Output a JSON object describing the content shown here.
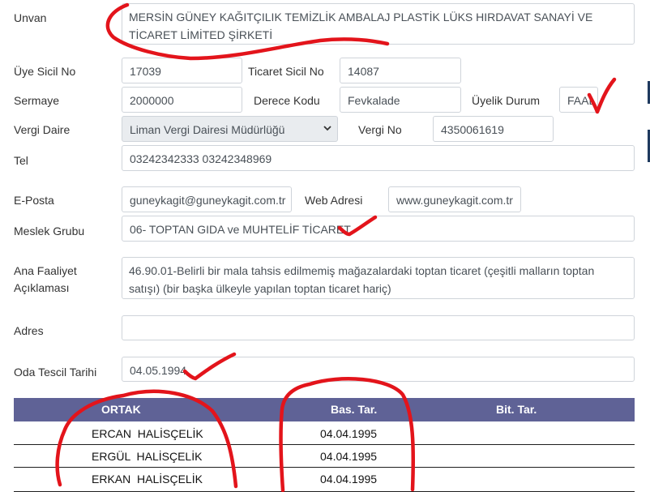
{
  "form": {
    "unvan": {
      "label": "Unvan",
      "value": "MERSİN GÜNEY KAĞITÇILIK TEMİZLİK AMBALAJ PLASTİK LÜKS HIRDAVAT SANAYİ VE TİCARET LİMİTED ŞİRKETİ"
    },
    "uye_sicil_no": {
      "label": "Üye Sicil No",
      "value": "17039"
    },
    "ticaret_sicil_no": {
      "label": "Ticaret Sicil No",
      "value": "14087"
    },
    "sermaye": {
      "label": "Sermaye",
      "value": "2000000"
    },
    "derece_kodu": {
      "label": "Derece Kodu",
      "value": "Fevkalade"
    },
    "uyelik_durum": {
      "label": "Üyelik Durum",
      "value": "FAAL"
    },
    "vergi_daire": {
      "label": "Vergi Daire",
      "value": "Liman Vergi Dairesi Müdürlüğü"
    },
    "vergi_no": {
      "label": "Vergi No",
      "value": "4350061619"
    },
    "tel": {
      "label": "Tel",
      "value": "03242342333 03242348969"
    },
    "e_posta": {
      "label": "E-Posta",
      "value": "guneykagit@guneykagit.com.tr"
    },
    "web_adresi": {
      "label": "Web Adresi",
      "value": "www.guneykagit.com.tr"
    },
    "meslek_grubu": {
      "label": "Meslek Grubu",
      "value": "06- TOPTAN GIDA ve MUHTELİF TİCARET"
    },
    "ana_faaliyet": {
      "label": "Ana Faaliyet Açıklaması",
      "value": "46.90.01-Belirli bir mala tahsis edilmemiş mağazalardaki toptan ticaret (çeşitli malların toptan satışı) (bir başka ülkeyle yapılan toptan ticaret hariç)"
    },
    "adres": {
      "label": "Adres",
      "value": ""
    },
    "oda_tescil_tarihi": {
      "label": "Oda Tescil Tarihi",
      "value": "04.05.1994"
    }
  },
  "partners_table": {
    "headers": [
      "ORTAK",
      "Bas. Tar.",
      "Bit. Tar."
    ],
    "rows": [
      {
        "ortak": "ERCAN  HALİSÇELİK",
        "bas_tar": "04.04.1995",
        "bit_tar": ""
      },
      {
        "ortak": "ERGÜL  HALİSÇELİK",
        "bas_tar": "04.04.1995",
        "bit_tar": ""
      },
      {
        "ortak": "ERKAN  HALİSÇELİK",
        "bas_tar": "04.04.1995",
        "bit_tar": ""
      }
    ]
  },
  "colors": {
    "table_header": "#5f6296",
    "annotation": "#e3141b",
    "readonly_field": "#e9ecef"
  }
}
